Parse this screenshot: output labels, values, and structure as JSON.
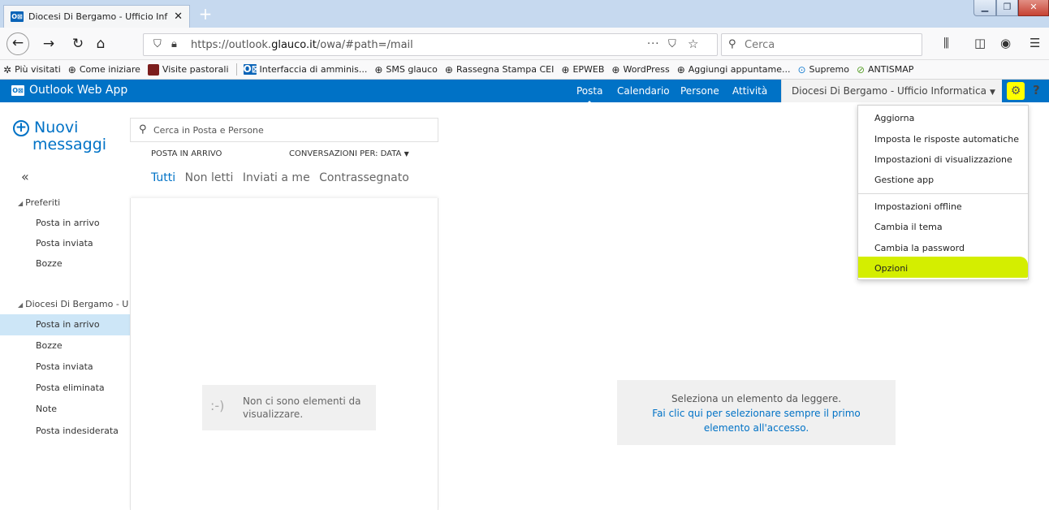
{
  "browser": {
    "tab_title": "Diocesi Di Bergamo - Ufficio Inf",
    "tab_close": "✕",
    "url_prefix": "https://outlook.",
    "url_domain": "glauco.it",
    "url_suffix": "/owa/#path=/mail",
    "search_placeholder": "Cerca",
    "bookmarks": [
      {
        "label": "Più visitati",
        "icon": "gear-icon"
      },
      {
        "label": "Come iniziare",
        "icon": "globe-icon"
      },
      {
        "label": "Visite pastorali",
        "icon": "red-square-icon"
      },
      {
        "label": "Interfaccia di amminis...",
        "icon": "outlook-icon"
      },
      {
        "label": "SMS glauco",
        "icon": "globe-icon"
      },
      {
        "label": "Rassegna Stampa CEI",
        "icon": "globe-icon"
      },
      {
        "label": "EPWEB",
        "icon": "globe-icon"
      },
      {
        "label": "WordPress",
        "icon": "globe-icon"
      },
      {
        "label": "Aggiungi appuntame...",
        "icon": "globe-icon"
      },
      {
        "label": "Supremo",
        "icon": "supremo-icon"
      },
      {
        "label": "ANTISMAP",
        "icon": "check-circle-icon"
      }
    ]
  },
  "owa": {
    "app_name": "Outlook Web App",
    "nav": [
      "Posta",
      "Calendario",
      "Persone",
      "Attività"
    ],
    "user": "Diocesi Di Bergamo - Ufficio Informatica",
    "help": "?"
  },
  "left": {
    "new_line1": "Nuovi",
    "new_line2": "messaggi",
    "collapse": "«",
    "favorites_title": "Preferiti",
    "favorites": [
      "Posta in arrivo",
      "Posta inviata",
      "Bozze"
    ],
    "account_title": "Diocesi Di Bergamo - U",
    "folders": [
      "Posta in arrivo",
      "Bozze",
      "Posta inviata",
      "Posta eliminata",
      "Note",
      "Posta indesiderata"
    ]
  },
  "list": {
    "search_placeholder": "Cerca in Posta e Persone",
    "inbox_label": "POSTA IN ARRIVO",
    "conversations_label": "CONVERSAZIONI PER: DATA",
    "filters": [
      "Tutti",
      "Non letti",
      "Inviati a me",
      "Contrassegnato"
    ],
    "empty_face": ":-)",
    "empty_text": "Non ci sono elementi da visualizzare."
  },
  "reading": {
    "line1": "Seleziona un elemento da leggere.",
    "line2": "Fai clic qui per selezionare sempre il primo elemento all'accesso."
  },
  "settings_menu": {
    "items": [
      "Aggiorna",
      "Imposta le risposte automatiche",
      "Impostazioni di visualizzazione",
      "Gestione app",
      "Impostazioni offline",
      "Cambia il tema",
      "Cambia la password",
      "Opzioni"
    ],
    "highlighted": "Opzioni"
  },
  "colors": {
    "owa_blue": "#0072c6",
    "highlight_yellow": "#d4ee00",
    "selected_folder": "#cde6f7"
  }
}
